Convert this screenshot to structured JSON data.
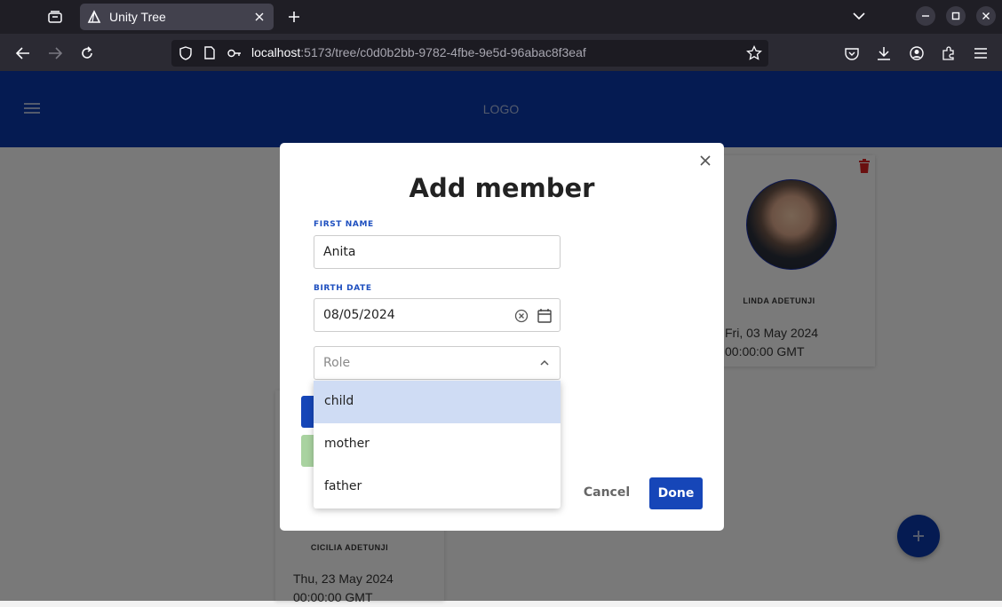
{
  "browser": {
    "tab_title": "Unity Tree",
    "url_host": "localhost",
    "url_rest": ":5173/tree/c0d0b2bb-9782-4fbe-9e5d-96abac8f3eaf"
  },
  "app": {
    "logo": "LOGO"
  },
  "cards": [
    {
      "name": "LINDA ADETUNJI",
      "date_line1": "Fri, 03 May 2024",
      "date_line2": "00:00:00 GMT"
    },
    {
      "name": "CICILIA ADETUNJI",
      "date_line1": "Thu, 23 May 2024",
      "date_line2": "00:00:00 GMT"
    }
  ],
  "modal": {
    "title": "Add member",
    "first_name_label": "FIRST NAME",
    "first_name_value": "Anita",
    "birth_date_label": "BIRTH DATE",
    "birth_date_value": "08/05/2024",
    "role_placeholder": "Role",
    "role_options": [
      "child",
      "mother",
      "father"
    ],
    "cancel_label": "Cancel",
    "done_label": "Done"
  },
  "colors": {
    "brand": "#0a37a5",
    "primary_button": "#1646b8",
    "selected_option": "#cfdcf4",
    "delete_icon": "#d42020"
  }
}
